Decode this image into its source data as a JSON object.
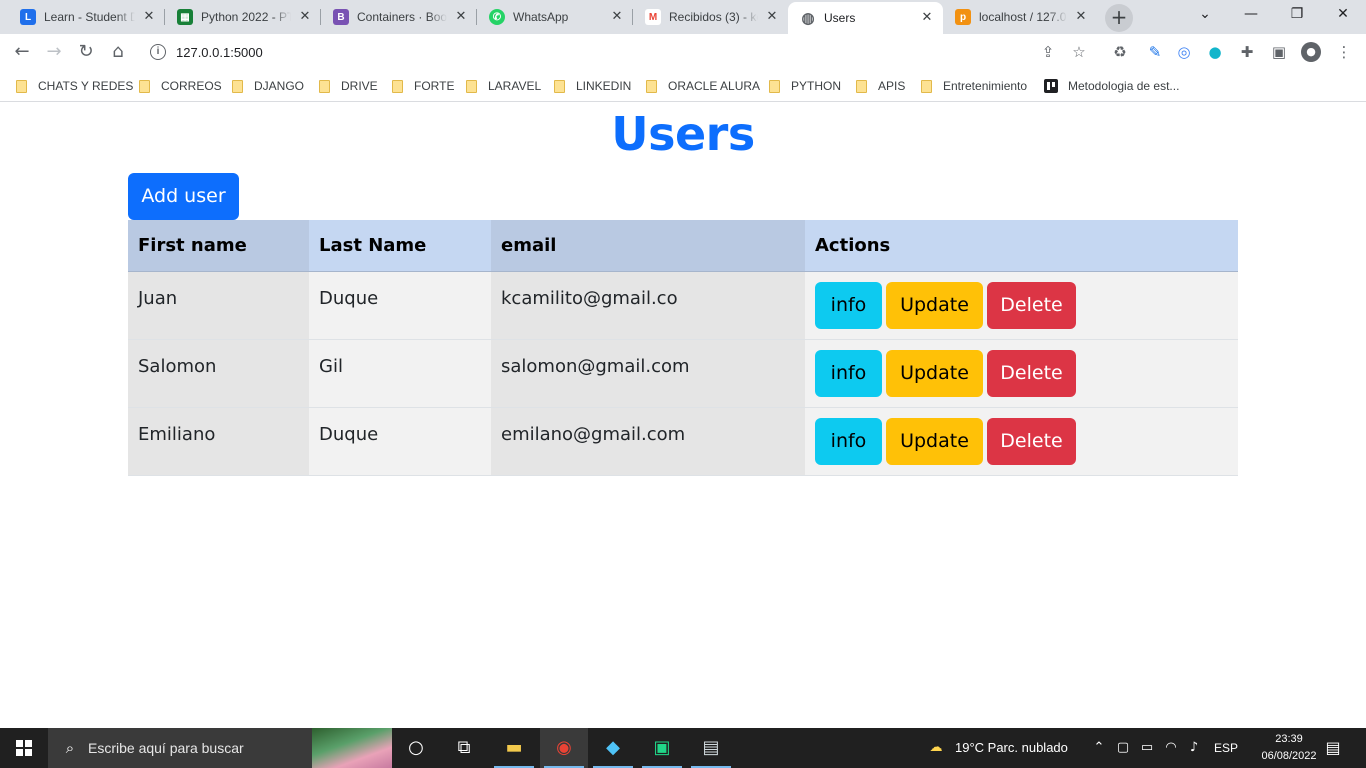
{
  "browser": {
    "tabs": [
      {
        "label": "Learn - Student D",
        "favicon": "learn-icon",
        "color": "#1f6feb",
        "glyph": "L"
      },
      {
        "label": "Python 2022 - PT",
        "favicon": "sheets-icon",
        "color": "#188038",
        "glyph": "▦"
      },
      {
        "label": "Containers · Boot",
        "favicon": "bootstrap-icon",
        "color": "#7952b3",
        "glyph": "B"
      },
      {
        "label": "WhatsApp",
        "favicon": "whatsapp-icon",
        "color": "#25d366",
        "glyph": "✆"
      },
      {
        "label": "Recibidos (3) - kc",
        "favicon": "gmail-icon",
        "color": "#ea4335",
        "glyph": "M"
      },
      {
        "label": "Users",
        "favicon": "globe-icon",
        "color": "#5f6368",
        "glyph": "◍"
      },
      {
        "label": "localhost / 127.0",
        "favicon": "phpmyadmin-icon",
        "color": "#f29111",
        "glyph": "p"
      }
    ],
    "active_tab_index": 5,
    "address": "127.0.0.1:5000",
    "bookmarks": [
      {
        "label": "CHATS Y REDES"
      },
      {
        "label": "CORREOS"
      },
      {
        "label": "DJANGO"
      },
      {
        "label": "DRIVE"
      },
      {
        "label": "FORTE"
      },
      {
        "label": "LARAVEL"
      },
      {
        "label": "LINKEDIN"
      },
      {
        "label": "ORACLE ALURA"
      },
      {
        "label": "PYTHON"
      },
      {
        "label": "APIS"
      },
      {
        "label": "Entretenimiento"
      },
      {
        "label": "Metodologia de est..."
      }
    ]
  },
  "page": {
    "title": "Users",
    "add_button": "Add user",
    "table": {
      "headers": [
        "First name",
        "Last Name",
        "email",
        "Actions"
      ],
      "rows": [
        {
          "first": "Juan",
          "last": "Duque",
          "email": "kcamilito@gmail.co"
        },
        {
          "first": "Salomon",
          "last": "Gil",
          "email": "salomon@gmail.com"
        },
        {
          "first": "Emiliano",
          "last": "Duque",
          "email": "emilano@gmail.com"
        }
      ],
      "actions": {
        "info": "info",
        "update": "Update",
        "delete": "Delete"
      }
    },
    "colors": {
      "primary": "#0d6efd",
      "info": "#0dcaf0",
      "warning": "#ffc107",
      "danger": "#dc3545"
    }
  },
  "taskbar": {
    "search_placeholder": "Escribe aquí para buscar",
    "weather": "19°C  Parc. nublado",
    "language": "ESP",
    "time": "23:39",
    "date": "06/08/2022"
  }
}
